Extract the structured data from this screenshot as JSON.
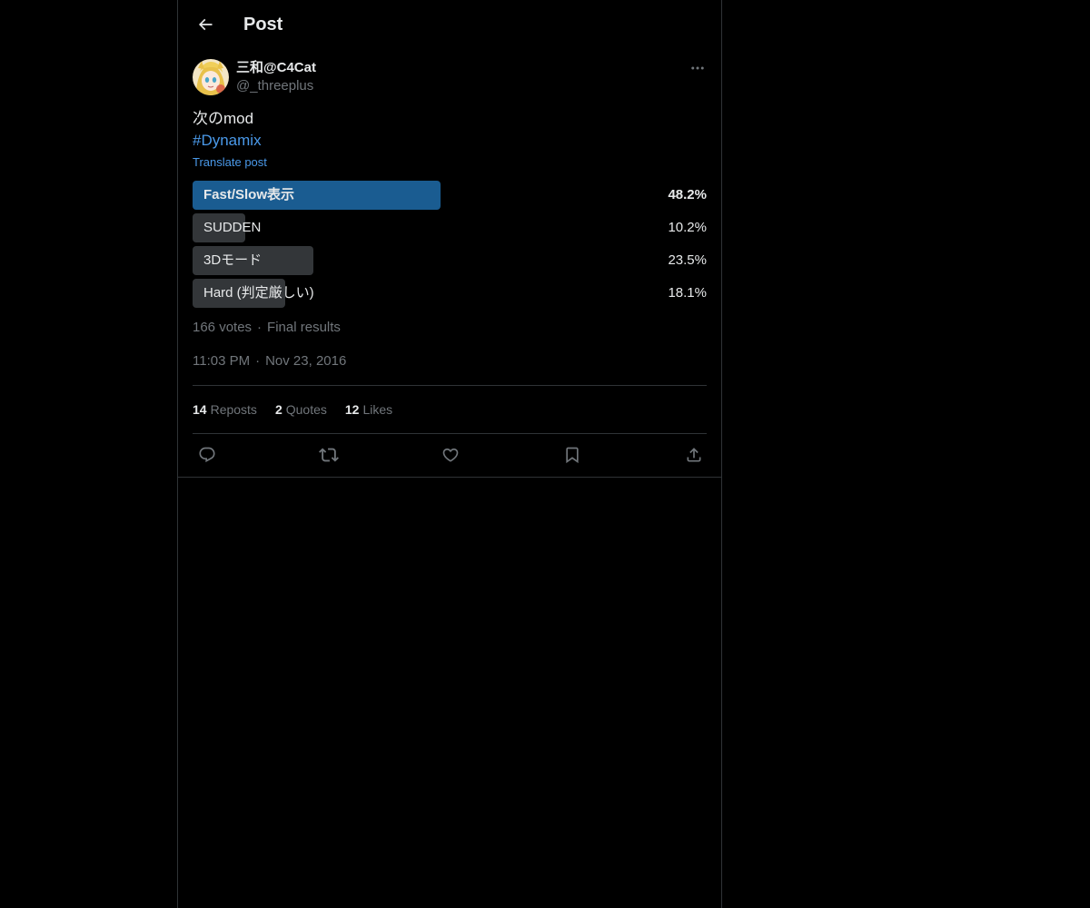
{
  "header": {
    "title": "Post",
    "back_icon": "arrow-left-icon"
  },
  "author": {
    "name": "三和@C4Cat",
    "handle": "@_threeplus"
  },
  "post": {
    "text": "次のmod",
    "hashtag": "#Dynamix",
    "translate_label": "Translate post"
  },
  "poll": {
    "options": [
      {
        "label": "Fast/Slow表示",
        "percent_label": "48.2%",
        "percent": 48.2,
        "winner": true
      },
      {
        "label": "SUDDEN",
        "percent_label": "10.2%",
        "percent": 10.2,
        "winner": false
      },
      {
        "label": "3Dモード",
        "percent_label": "23.5%",
        "percent": 23.5,
        "winner": false
      },
      {
        "label": "Hard (判定厳しい)",
        "percent_label": "18.1%",
        "percent": 18.1,
        "winner": false
      }
    ],
    "votes": "166 votes",
    "status": "Final results"
  },
  "meta": {
    "time": "11:03 PM",
    "date": "Nov 23, 2016"
  },
  "stats": {
    "reposts_count": "14",
    "reposts_label": "Reposts",
    "quotes_count": "2",
    "quotes_label": "Quotes",
    "likes_count": "12",
    "likes_label": "Likes"
  },
  "colors": {
    "background": "#000000",
    "text": "#e7e9ea",
    "secondary": "#71767b",
    "link": "#4a99e9",
    "winner_bar": "#1a5c91",
    "bar": "#333639",
    "border": "#2f3336"
  }
}
